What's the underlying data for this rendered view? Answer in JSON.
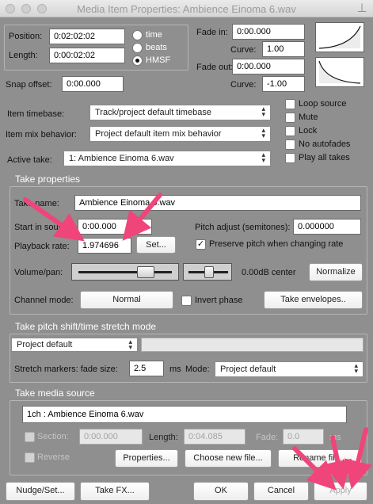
{
  "window": {
    "title": "Media Item Properties:  Ambience Einoma 6.wav"
  },
  "item": {
    "position_label": "Position:",
    "position_value": "0:02:02:02",
    "length_label": "Length:",
    "length_value": "0:00:02:02",
    "time_format": {
      "options": [
        "time",
        "beats",
        "HMSF"
      ],
      "selected": "HMSF"
    },
    "snap_offset_label": "Snap offset:",
    "snap_offset_value": "0:00.000",
    "fade_in_label": "Fade in:",
    "fade_in_value": "0:00.000",
    "fade_in_curve_label": "Curve:",
    "fade_in_curve_value": "1.00",
    "fade_out_label": "Fade out:",
    "fade_out_value": "0:00.000",
    "fade_out_curve_label": "Curve:",
    "fade_out_curve_value": "-1.00",
    "timebase_label": "Item timebase:",
    "timebase_value": "Track/project default timebase",
    "mix_label": "Item mix behavior:",
    "mix_value": "Project default item mix behavior",
    "active_take_label": "Active take:",
    "active_take_value": "1: Ambience Einoma 6.wav",
    "checkboxes": [
      {
        "label": "Loop source",
        "checked": false
      },
      {
        "label": "Mute",
        "checked": false
      },
      {
        "label": "Lock",
        "checked": false
      },
      {
        "label": "No autofades",
        "checked": false
      },
      {
        "label": "Play all takes",
        "checked": false
      }
    ]
  },
  "take": {
    "section_title": "Take properties",
    "name_label": "Take name:",
    "name_value": "Ambience Einoma 6.wav",
    "start_label": "Start in source:",
    "start_value": "0:00.000",
    "pitch_label": "Pitch adjust (semitones):",
    "pitch_value": "0.000000",
    "rate_label": "Playback rate:",
    "rate_value": "1.974696",
    "set_button": "Set...",
    "preserve_pitch_label": "Preserve pitch when changing rate",
    "preserve_pitch_checked": true,
    "volpan_label": "Volume/pan:",
    "volpan_value": "0.00dB  center",
    "volume_level": 0.72,
    "pan_level": 0.5,
    "normalize_button": "Normalize",
    "channel_label": "Channel mode:",
    "channel_button": "Normal",
    "invert_phase_label": "Invert phase",
    "invert_phase_checked": false,
    "envelopes_button": "Take envelopes.."
  },
  "stretch": {
    "section_title": "Take pitch shift/time stretch mode",
    "mode_value": "Project default",
    "fade_label": "Stretch markers: fade size:",
    "fade_value": "2.5",
    "ms_label": "ms",
    "mode_label": "Mode:",
    "mode2_value": "Project default"
  },
  "source": {
    "section_title": "Take media source",
    "source_value": "1ch  : Ambience Einoma 6.wav",
    "section_label": "Section:",
    "section_value": "0:00.000",
    "length_label": "Length:",
    "length_value": "0:04.085",
    "fade_label": "Fade:",
    "fade_value": "0.0",
    "ms_label": "ms",
    "reverse_label": "Reverse",
    "properties_button": "Properties...",
    "choose_button": "Choose new file...",
    "rename_button": "Rename file..."
  },
  "footer": {
    "nudge_button": "Nudge/Set...",
    "fx_button": "Take FX...",
    "ok_button": "OK",
    "cancel_button": "Cancel",
    "apply_button": "Apply"
  },
  "annotation": {
    "arrow_color": "#f0457a"
  }
}
